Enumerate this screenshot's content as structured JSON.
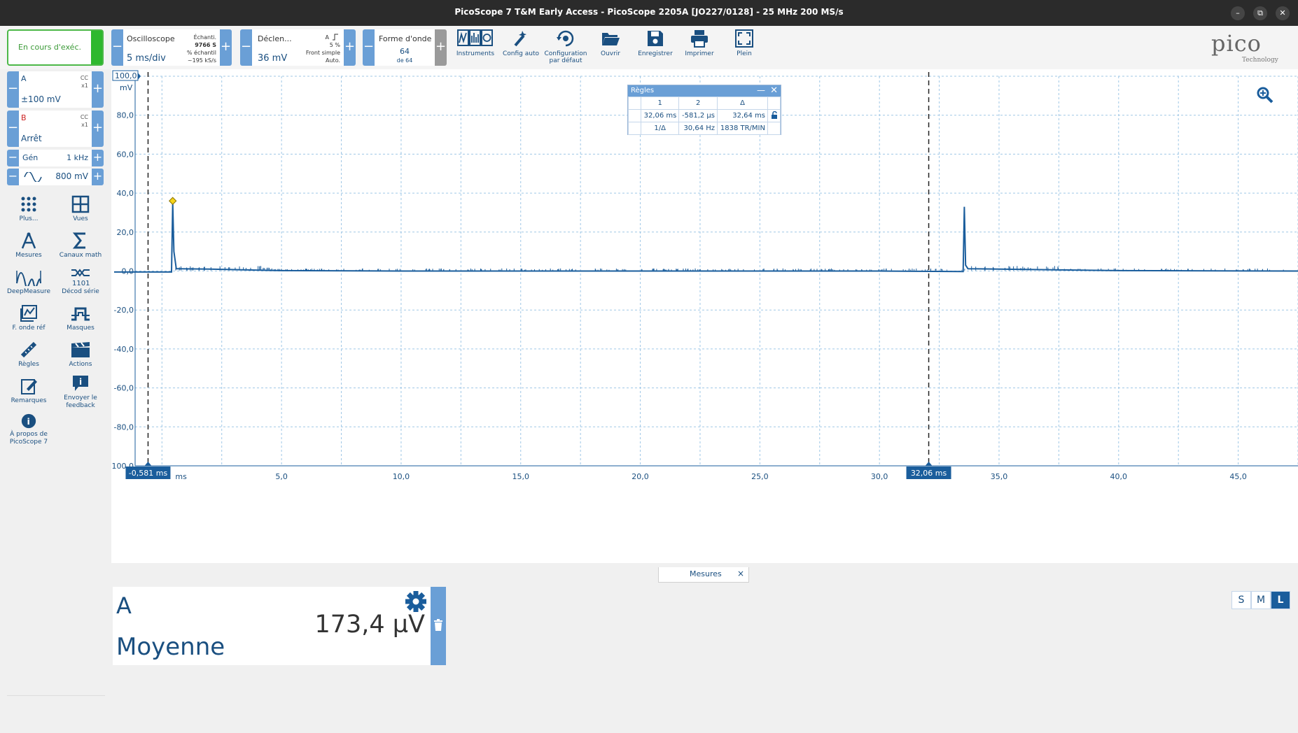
{
  "window": {
    "title": "PicoScope 7 T&M Early Access  - PicoScope 2205A [JO227/0128] - 25 MHz 200 MS/s",
    "buttons": [
      "–",
      "⧉",
      "✕"
    ]
  },
  "toolbar": {
    "run_label": "En cours d'exéc.",
    "scope": {
      "caption": "Oscilloscope",
      "value": "5 ms/div",
      "info1": "Échanti.",
      "info2": "9766 S",
      "info3": "% échantil",
      "info4": "~195 kS/s"
    },
    "trigger": {
      "caption": "Déclen...",
      "value": "36 mV",
      "info1": "A",
      "info2": "5 %",
      "info3": "Front simple",
      "info4": "Auto."
    },
    "waveform": {
      "caption": "Forme d'onde",
      "value": "64",
      "sub": "de 64"
    },
    "tools": [
      {
        "name": "instruments",
        "label": "Instruments"
      },
      {
        "name": "config-auto",
        "label": "Config auto"
      },
      {
        "name": "default-config",
        "label": "Configuration par défaut"
      },
      {
        "name": "open",
        "label": "Ouvrir"
      },
      {
        "name": "save",
        "label": "Enregistrer"
      },
      {
        "name": "print",
        "label": "Imprimer"
      },
      {
        "name": "fullscreen",
        "label": "Plein"
      }
    ],
    "logo": {
      "text": "pico",
      "sub": "Technology"
    }
  },
  "channels": {
    "a": {
      "name": "A",
      "coupling": "CC",
      "probe": "x1",
      "range": "±100 mV",
      "color": "#1a4f80"
    },
    "b": {
      "name": "B",
      "coupling": "CC",
      "probe": "x1",
      "range": "Arrêt",
      "color": "#cc2222"
    }
  },
  "generator": {
    "label": "Gén",
    "freq": "1 kHz",
    "amplitude": "800 mV"
  },
  "left_tools": [
    {
      "name": "more",
      "label": "Plus..."
    },
    {
      "name": "views",
      "label": "Vues"
    },
    {
      "name": "measurements",
      "label": "Mesures"
    },
    {
      "name": "math-channels",
      "label": "Canaux math"
    },
    {
      "name": "deepmeasure",
      "label": "DeepMeasure"
    },
    {
      "name": "serial-decode",
      "label": "Décod série"
    },
    {
      "name": "ref-waveform",
      "label": "F. onde réf"
    },
    {
      "name": "masks",
      "label": "Masques"
    },
    {
      "name": "rulers",
      "label": "Règles"
    },
    {
      "name": "actions",
      "label": "Actions"
    },
    {
      "name": "notes",
      "label": "Remarques"
    },
    {
      "name": "feedback",
      "label": "Envoyer le feedback"
    },
    {
      "name": "about",
      "label": "À propos de PicoScope 7"
    }
  ],
  "chart_data": {
    "type": "line",
    "yunit": "mV",
    "y_ticks": [
      "100,0",
      "80,0",
      "60,0",
      "40,0",
      "20,0",
      "0,0",
      "-20,0",
      "-40,0",
      "-60,0",
      "-80,0",
      "-100,0"
    ],
    "x_ticks": [
      "ms",
      "5,0",
      "10,0",
      "15,0",
      "20,0",
      "25,0",
      "30,0",
      "35,0",
      "40,0",
      "45,0"
    ],
    "xlim": [
      -2.0,
      47.5
    ],
    "ylim": [
      -100,
      100
    ],
    "grid": true,
    "color": "#1a5d9c",
    "series": [
      {
        "x": [
          -2.0,
          -0.2,
          0.4,
          0.45,
          0.5,
          0.6,
          2.0,
          5.0,
          10.0,
          20.0,
          30.0,
          33.5,
          33.55,
          33.6,
          33.7,
          35.0,
          40.0,
          47.5
        ],
        "y": [
          -0.5,
          -0.5,
          -0.5,
          35,
          10,
          1.2,
          1.0,
          0.2,
          0.0,
          0.0,
          0.0,
          -0.3,
          33,
          3.0,
          1.2,
          1.0,
          0.2,
          0.0
        ]
      }
    ],
    "trigger_marker": {
      "x": 0.45,
      "y": 36
    },
    "rulers": [
      {
        "x": -0.581,
        "label": "-0,581 ms"
      },
      {
        "x": 32.06,
        "label": "32,06 ms"
      }
    ]
  },
  "rulers_window": {
    "title": "Règles",
    "cols": [
      "1",
      "2",
      "Δ"
    ],
    "row1": [
      "32,06 ms",
      "-581,2 µs",
      "32,64 ms"
    ],
    "row2": [
      "1/Δ",
      "30,64 Hz",
      "1838 TR/MIN"
    ]
  },
  "measures": {
    "tab_label": "Mesures",
    "channel": "A",
    "name": "Moyenne",
    "value": "173,4 µV"
  },
  "size_buttons": [
    "S",
    "M",
    "L"
  ]
}
